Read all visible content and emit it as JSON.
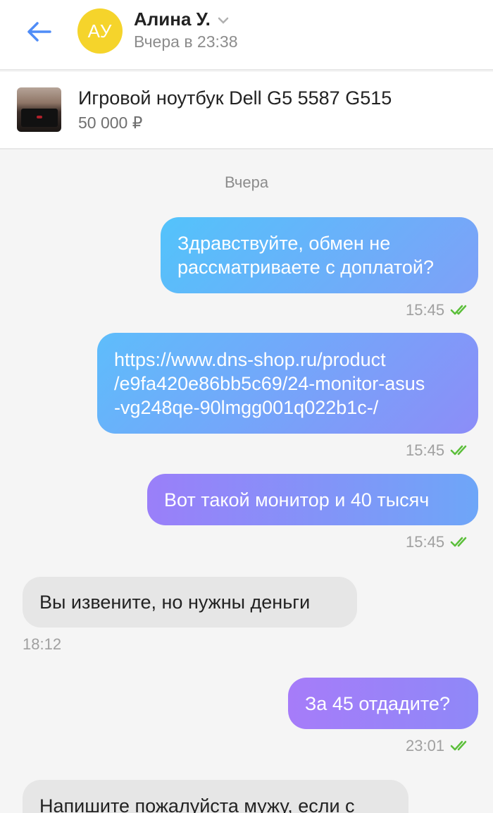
{
  "header": {
    "back_icon": "arrow-left-icon",
    "avatar_initials": "АУ",
    "avatar_color": "#f5d42b",
    "contact_name": "Алина У.",
    "last_seen": "Вчера в 23:38"
  },
  "product": {
    "title": "Игровой ноутбук Dell G5 5587 G515",
    "price": "50 000 ₽"
  },
  "chat": {
    "date_separator": "Вчера",
    "messages": [
      {
        "direction": "outgoing",
        "text_lines": [
          "Здравствуйте, обмен не",
          "рассматриваете с доплатой?"
        ],
        "time": "15:45",
        "status": "read"
      },
      {
        "direction": "outgoing",
        "text_lines": [
          "https://www.dns-shop.ru/product",
          "/e9fa420e86bb5c69/24-monitor-asus",
          "-vg248qe-90lmgg001q022b1c-/"
        ],
        "time": "15:45",
        "status": "read"
      },
      {
        "direction": "outgoing",
        "text_lines": [
          "Вот такой монитор и 40 тысяч"
        ],
        "time": "15:45",
        "status": "read"
      },
      {
        "direction": "incoming",
        "text_lines": [
          "Вы извените, но нужны деньги"
        ],
        "time": "18:12"
      },
      {
        "direction": "outgoing",
        "text_lines": [
          "За 45 отдадите?"
        ],
        "time": "23:01",
        "status": "read"
      },
      {
        "direction": "incoming",
        "text_lines": [
          "Напишите пожалуйста мужу, если с"
        ]
      }
    ]
  },
  "colors": {
    "accent_blue": "#4f8cf7",
    "outgoing_gradient_start": "#53c3fb",
    "outgoing_gradient_end": "#a07cf8",
    "read_ticks": "#5bbf3a"
  }
}
